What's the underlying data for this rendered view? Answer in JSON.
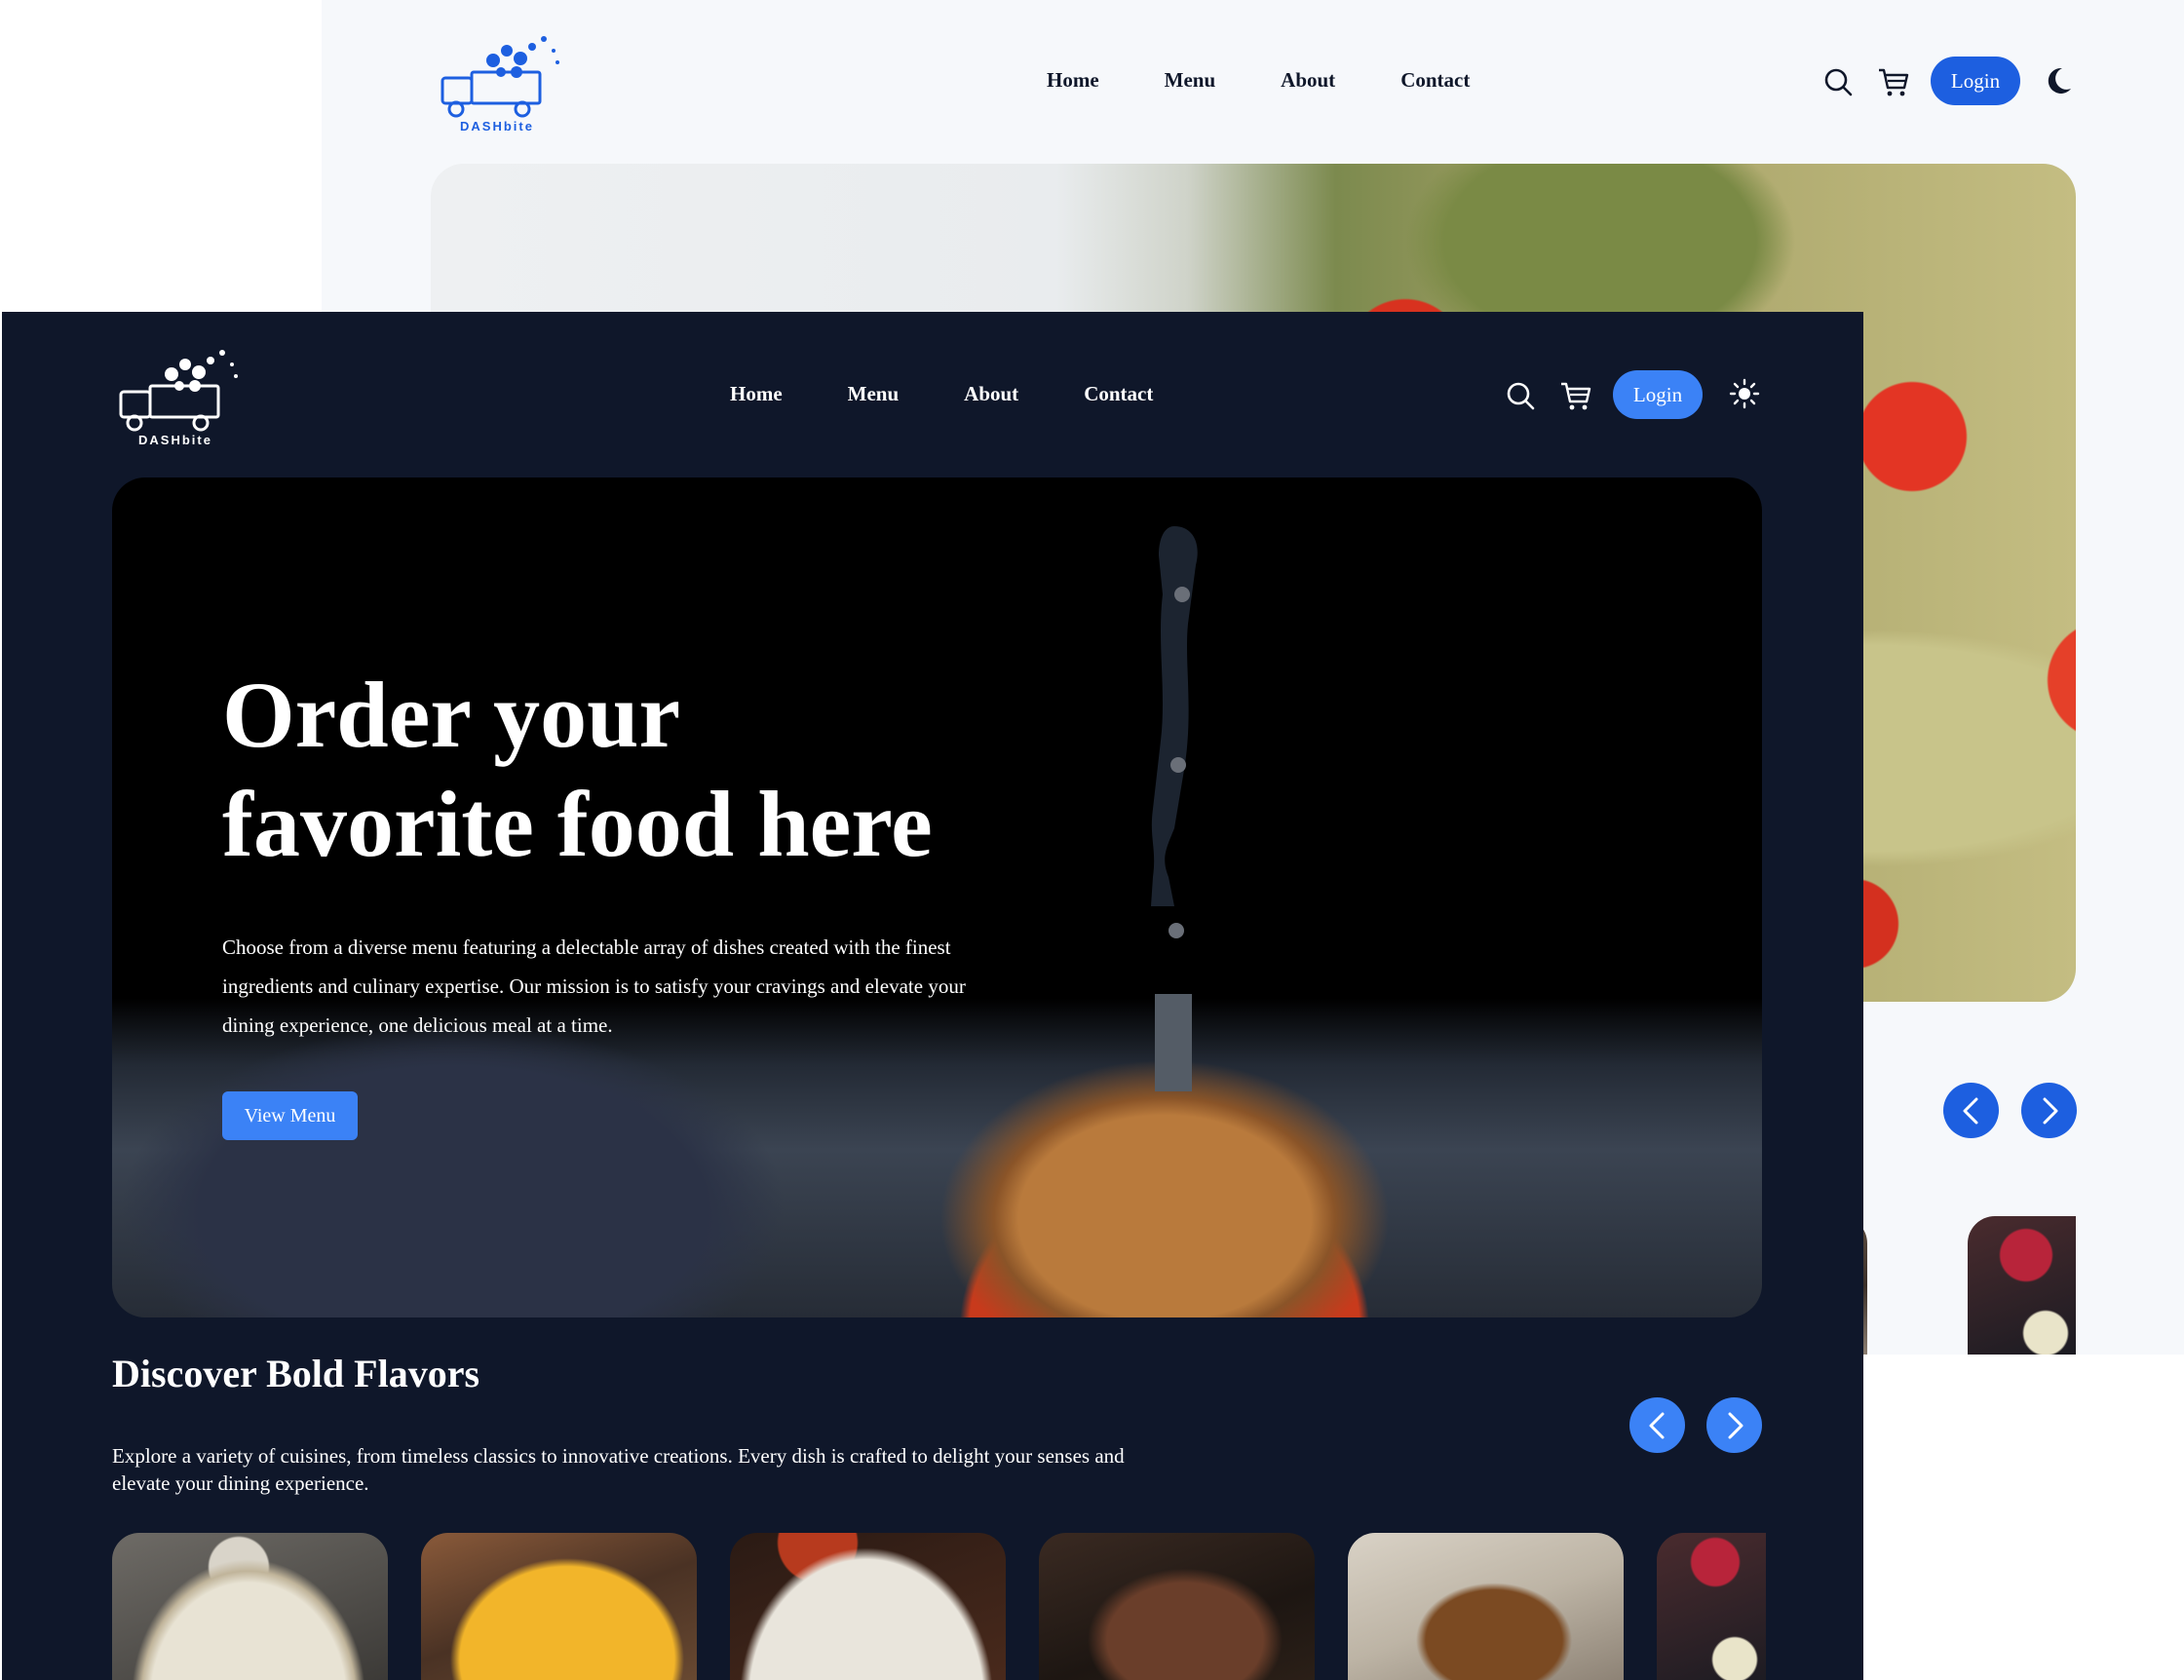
{
  "light_window": {
    "logo_text": "DASHbite",
    "nav": [
      "Home",
      "Menu",
      "About",
      "Contact"
    ],
    "login_label": "Login",
    "theme_icon": "moon-icon"
  },
  "dark_window": {
    "logo_text": "DASHbite",
    "nav": [
      "Home",
      "Menu",
      "About",
      "Contact"
    ],
    "login_label": "Login",
    "theme_icon": "sun-icon",
    "hero": {
      "title_line1": "Order your",
      "title_line2": "favorite food here",
      "description": "Choose from a diverse menu featuring a delectable array of dishes created with the finest ingredients and culinary expertise. Our mission is to satisfy your cravings and elevate your dining experience, one delicious meal at a time.",
      "cta_label": "View Menu"
    },
    "section": {
      "title": "Discover Bold Flavors",
      "description": "Explore a variety of cuisines, from timeless classics to innovative creations. Every dish is crafted to delight your senses and elevate your dining experience."
    }
  },
  "colors": {
    "accent_light": "#1d5fe0",
    "accent_dark": "#3b82f6",
    "dark_bg": "#0f172a",
    "light_bg": "#f6f8fb"
  }
}
